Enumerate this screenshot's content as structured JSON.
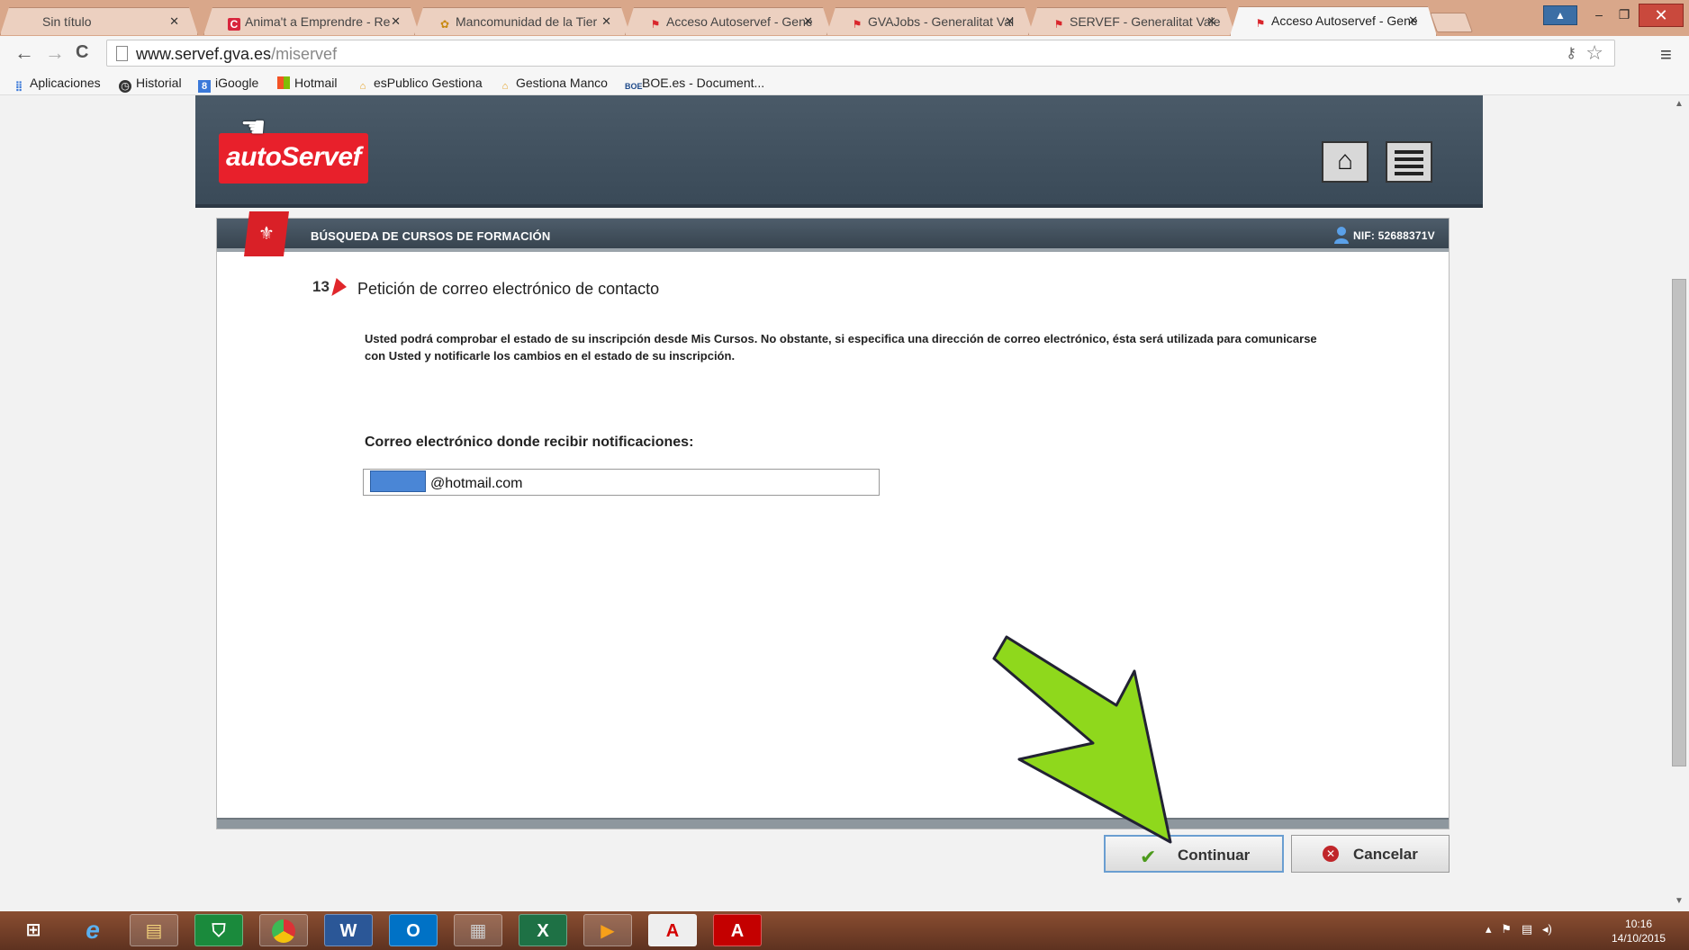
{
  "browser": {
    "tabs": [
      {
        "label": "Sin título",
        "favicon": ""
      },
      {
        "label": "Anima't a Emprendre - Re",
        "favicon": "C"
      },
      {
        "label": "Mancomunidad de la Tier",
        "favicon": "✿"
      },
      {
        "label": "Acceso Autoservef - Gene",
        "favicon": "⚑"
      },
      {
        "label": "GVAJobs - Generalitat Val",
        "favicon": "⚑"
      },
      {
        "label": "SERVEF - Generalitat Vale",
        "favicon": "⚑"
      },
      {
        "label": "Acceso Autoservef - Gene",
        "favicon": "⚑",
        "active": true
      }
    ],
    "url_host": "www.servef.gva.es",
    "url_path": "/miservef",
    "bookmarks": [
      {
        "label": "Aplicaciones",
        "icon": "apps-grid-icon"
      },
      {
        "label": "Historial",
        "icon": "clock-icon"
      },
      {
        "label": "iGoogle",
        "icon": "igoogle-icon"
      },
      {
        "label": "Hotmail",
        "icon": "windows-icon"
      },
      {
        "label": "esPublico Gestiona",
        "icon": "espublico-icon"
      },
      {
        "label": "Gestiona Manco",
        "icon": "espublico-icon"
      },
      {
        "label": "BOE.es - Document...",
        "icon": "boe-icon"
      }
    ]
  },
  "app": {
    "logo_text": "autoServef",
    "section_title": "Búsqueda de cursos de formación",
    "nif": "NIF: 52688371V",
    "step_number": "13",
    "step_title": "Petición de correo electrónico de contacto",
    "info_text": "Usted podrá comprobar el estado de su inscripción desde Mis Cursos. No obstante, si especifica una dirección de correo electrónico, ésta será utilizada para comunicarse con Usted y notificarle los cambios en el estado de su inscripción.",
    "email_label": "Correo electrónico donde recibir notificaciones:",
    "email_value": "@hotmail.com",
    "continue_label": "Continuar",
    "cancel_label": "Cancelar"
  },
  "taskbar": {
    "apps": [
      "start",
      "internet-explorer",
      "file-explorer",
      "store",
      "chrome",
      "word",
      "outlook",
      "calculator",
      "excel",
      "media-player",
      "acrobat",
      "acrobat"
    ],
    "time": "10:16",
    "date": "14/10/2015"
  },
  "colors": {
    "brand_red": "#e8202b",
    "header_dark": "#3a4a58",
    "annotation_arrow": "#8fd81c"
  }
}
